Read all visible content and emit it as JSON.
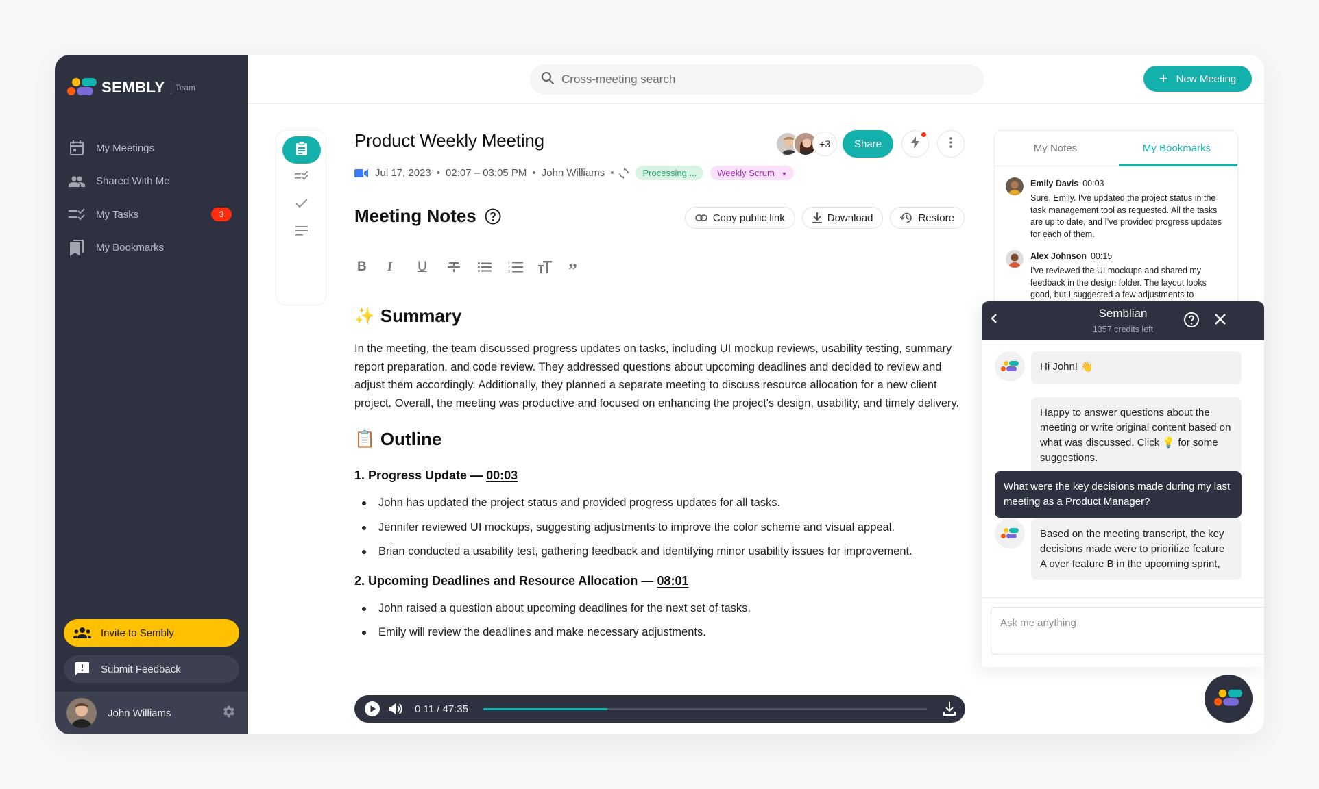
{
  "brand": {
    "name": "SEMBLY",
    "plan": "Team"
  },
  "sidebar": {
    "items": [
      {
        "label": "My Meetings",
        "icon": "calendar-icon"
      },
      {
        "label": "Shared With Me",
        "icon": "people-icon"
      },
      {
        "label": "My Tasks",
        "icon": "tasks-icon",
        "badge": "3"
      },
      {
        "label": "My Bookmarks",
        "icon": "bookmarks-icon"
      }
    ],
    "invite_label": "Invite to Sembly",
    "feedback_label": "Submit Feedback",
    "user": {
      "name": "John Williams"
    }
  },
  "topbar": {
    "search_placeholder": "Cross-meeting search",
    "new_meeting_label": "New Meeting"
  },
  "meeting": {
    "title": "Product Weekly Meeting",
    "date": "Jul 17, 2023",
    "time": "02:07 – 03:05 PM",
    "owner": "John Williams",
    "status": "Processing ...",
    "tag": "Weekly Scrum",
    "participants_more": "+3",
    "share_label": "Share"
  },
  "notes": {
    "heading": "Meeting Notes",
    "actions": {
      "copy_link": "Copy public link",
      "download": "Download",
      "restore": "Restore"
    },
    "toolbar": [
      "bold",
      "italic",
      "underline",
      "strikethrough",
      "bulleted-list",
      "numbered-list",
      "text-size",
      "quote"
    ],
    "summary": {
      "emoji": "✨",
      "title": "Summary",
      "text": "In the meeting, the team discussed progress updates on tasks, including UI mockup reviews, usability testing, summary report preparation, and code review. They addressed questions about upcoming deadlines and decided to review and adjust them accordingly. Additionally, they planned a separate meeting to discuss resource allocation for a new client project. Overall, the meeting was productive and focused on enhancing the project's design, usability, and timely delivery."
    },
    "outline": {
      "emoji": "📋",
      "title": "Outline",
      "sections": [
        {
          "title": "1. Progress Update —",
          "timestamp": "00:03",
          "bullets": [
            "John has updated the project status and provided progress updates for all tasks.",
            "Jennifer reviewed UI mockups, suggesting adjustments to improve the color scheme and visual appeal.",
            "Brian conducted a usability test, gathering feedback and identifying minor usability issues for improvement."
          ]
        },
        {
          "title": "2. Upcoming Deadlines and Resource Allocation —",
          "timestamp": "08:01",
          "bullets": [
            "John raised a question about upcoming deadlines for the next set of tasks.",
            "Emily will review the deadlines and make necessary adjustments."
          ]
        }
      ]
    }
  },
  "player": {
    "current": "0:11",
    "total": "47:35",
    "time_display": "0:11 / 47:35",
    "progress_fraction": 0.28
  },
  "right_panel": {
    "tabs": [
      {
        "label": "My Notes",
        "active": false
      },
      {
        "label": "My Bookmarks",
        "active": true
      }
    ],
    "bookmarks": [
      {
        "name": "Emily Davis",
        "time": "00:03",
        "text": "Sure, Emily. I've updated the project status in the task management tool as requested. All the tasks are up to date, and I've provided progress updates for each of them."
      },
      {
        "name": "Alex Johnson",
        "time": "00:15",
        "text": "I've reviewed the UI mockups and shared my feedback in the design folder. The layout looks good, but I suggested a few adjustments to"
      }
    ]
  },
  "chat": {
    "title": "Semblian",
    "credits": "1357 credits left",
    "messages": [
      {
        "from": "bot",
        "text": "Hi John! 👋"
      },
      {
        "from": "bot",
        "text": "Happy to answer questions about the meeting or write original content based on what was discussed. Click 💡 for some suggestions."
      },
      {
        "from": "user",
        "text": "What were the key decisions made during my last meeting as a Product Manager?"
      },
      {
        "from": "bot",
        "text": "Based on the meeting transcript, the key decisions made were to prioritize feature A over feature B in the upcoming sprint,"
      }
    ],
    "input_placeholder": "Ask me anything"
  },
  "colors": {
    "accent": "#14b1ac",
    "sidebar": "#2e3140",
    "badge": "#ff2d10",
    "invite": "#ffc000"
  }
}
